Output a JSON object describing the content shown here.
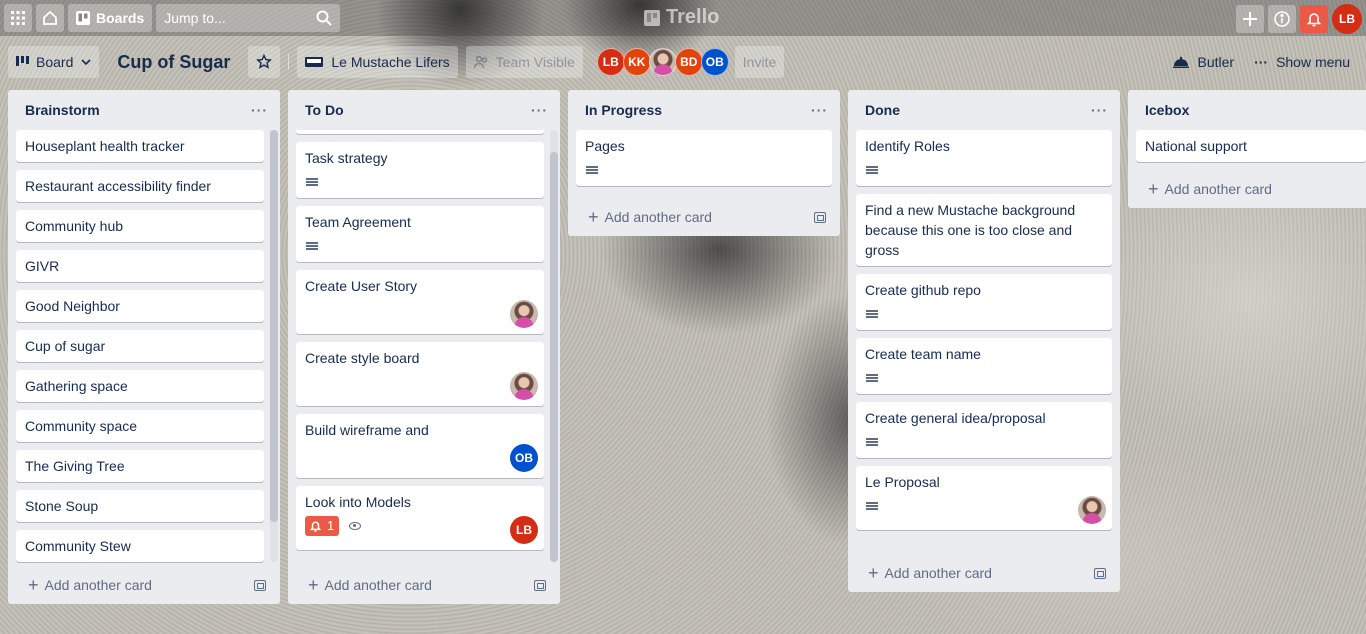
{
  "app": {
    "logo_text": "Trello",
    "boards_label": "Boards",
    "search_placeholder": "Jump to...",
    "user_initials": "LB"
  },
  "board": {
    "view_label": "Board",
    "title": "Cup of Sugar",
    "team_label": "Le Mustache Lifers",
    "visibility_label": "Team Visible",
    "members": [
      {
        "initials": "LB",
        "color": "#d42d14"
      },
      {
        "initials": "KK",
        "color": "#e0430c"
      },
      {
        "initials": "",
        "photo": true
      },
      {
        "initials": "BD",
        "color": "#e0430c"
      },
      {
        "initials": "OB",
        "color": "#0052cc"
      }
    ],
    "invite_label": "Invite",
    "butler_label": "Butler",
    "show_menu_label": "Show menu"
  },
  "lists": [
    {
      "name": "Brainstorm",
      "add_card_label": "Add another card",
      "cards": [
        {
          "title": "Houseplant health tracker"
        },
        {
          "title": "Restaurant accessibility finder"
        },
        {
          "title": "Community hub"
        },
        {
          "title": "GIVR"
        },
        {
          "title": "Good Neighbor"
        },
        {
          "title": "Cup of sugar"
        },
        {
          "title": "Gathering space"
        },
        {
          "title": "Community space"
        },
        {
          "title": "The Giving Tree"
        },
        {
          "title": "Stone Soup"
        },
        {
          "title": "Community Stew"
        }
      ]
    },
    {
      "name": "To Do",
      "add_card_label": "Add another card",
      "cards": [
        {
          "title": "Task strategy",
          "has_description": true
        },
        {
          "title": "Team Agreement",
          "has_description": true
        },
        {
          "title": "Create User Story",
          "member": "photo"
        },
        {
          "title": "Create style board",
          "member": "photo"
        },
        {
          "title": "Build wireframe and",
          "member": "OB"
        },
        {
          "title": "Look into Models",
          "notifications": "1",
          "watching": true,
          "member": "LB"
        }
      ]
    },
    {
      "name": "In Progress",
      "add_card_label": "Add another card",
      "cards": [
        {
          "title": "Pages",
          "has_description": true
        }
      ]
    },
    {
      "name": "Done",
      "add_card_label": "Add another card",
      "cards": [
        {
          "title": "Identify Roles",
          "has_description": true
        },
        {
          "title": "Find a new Mustache background because this one is too close and gross"
        },
        {
          "title": "Create github repo",
          "has_description": true
        },
        {
          "title": "Create team name",
          "has_description": true
        },
        {
          "title": "Create general idea/proposal",
          "has_description": true
        },
        {
          "title": "Le Proposal",
          "has_description": true,
          "member": "photo"
        }
      ]
    },
    {
      "name": "Icebox",
      "add_card_label": "Add another card",
      "cards": [
        {
          "title": "National support"
        }
      ]
    }
  ]
}
